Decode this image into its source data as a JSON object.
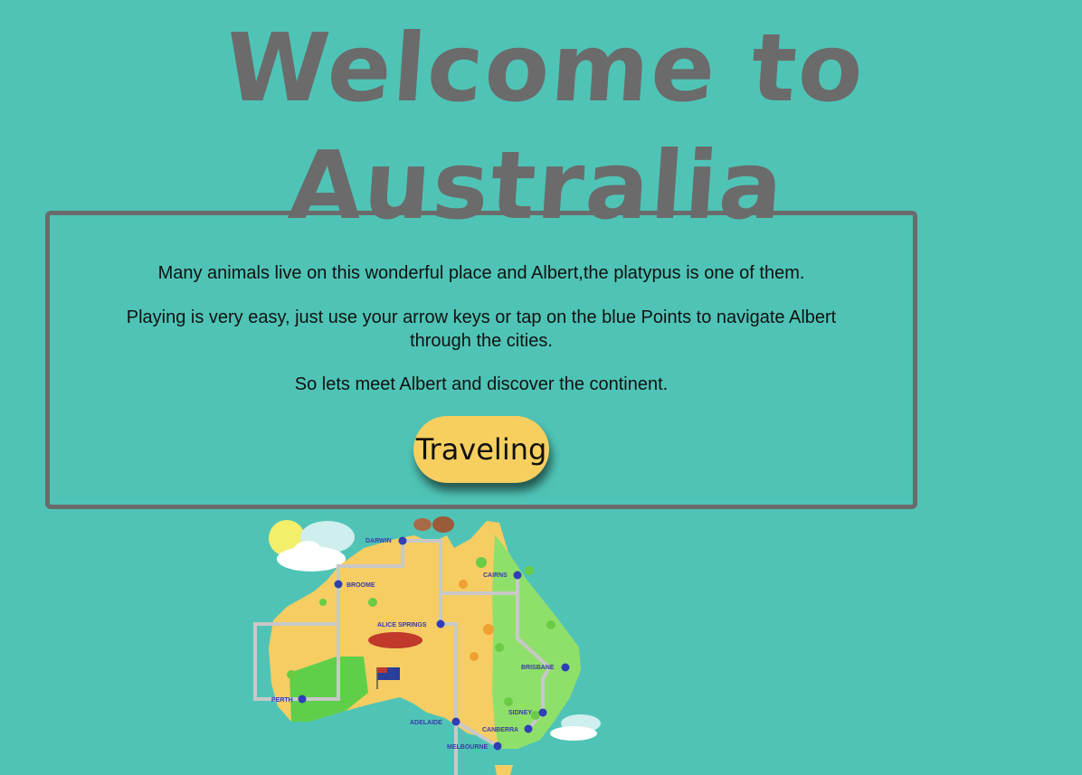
{
  "title": "Welcome to Australia",
  "intro": {
    "paragraph1": "Many animals live on this wonderful place and Albert,the platypus is one of them.",
    "paragraph2": "Playing is very easy, just use your arrow keys or tap on the blue Points to navigate Albert through the cities.",
    "paragraph3": "So lets meet Albert and discover the continent.",
    "button_label": "Traveling"
  },
  "map": {
    "cities": [
      "DARWIN",
      "BROOME",
      "CAIRNS",
      "ALICE SPRINGS",
      "BRISBANE",
      "PERTH",
      "SIDNEY",
      "ADELAIDE",
      "CANBERRA",
      "MELBOURNE"
    ]
  },
  "colors": {
    "background": "#4fc4b6",
    "title": "#6b6b6b",
    "button": "#f6cf5f",
    "city_point": "#2f3db8",
    "land": "#f5cd63",
    "green_region": "#8fe06a"
  }
}
